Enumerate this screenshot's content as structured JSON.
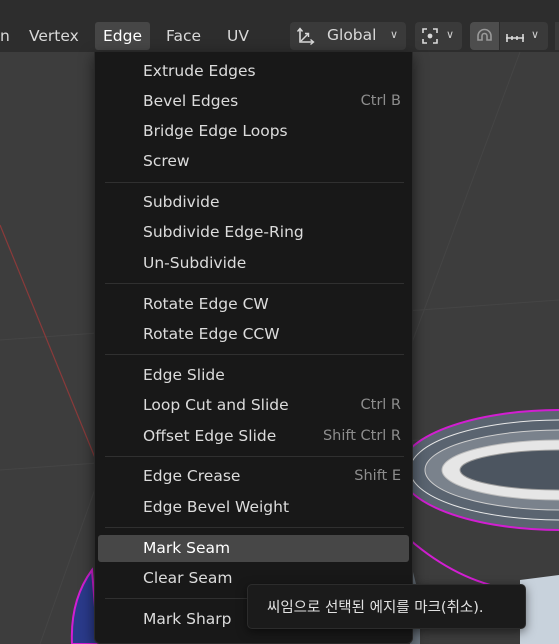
{
  "header": {
    "menus": [
      {
        "label": "n"
      },
      {
        "label": "Vertex"
      },
      {
        "label": "Edge",
        "active": true
      },
      {
        "label": "Face"
      },
      {
        "label": "UV"
      }
    ],
    "transform_orientation": {
      "label": "Global",
      "icon": "transform-orientation-icon"
    },
    "pivot_icon": "pivot-point-icon",
    "snap_icon": "snap-magnet-icon",
    "snap_target_icon": "snap-increment-icon"
  },
  "edge_menu": {
    "groups": [
      [
        {
          "label": "Extrude Edges",
          "shortcut": ""
        },
        {
          "label": "Bevel Edges",
          "shortcut": "Ctrl B"
        },
        {
          "label": "Bridge Edge Loops",
          "shortcut": ""
        },
        {
          "label": "Screw",
          "shortcut": ""
        }
      ],
      [
        {
          "label": "Subdivide",
          "shortcut": ""
        },
        {
          "label": "Subdivide Edge-Ring",
          "shortcut": ""
        },
        {
          "label": "Un-Subdivide",
          "shortcut": ""
        }
      ],
      [
        {
          "label": "Rotate Edge CW",
          "shortcut": ""
        },
        {
          "label": "Rotate Edge CCW",
          "shortcut": ""
        }
      ],
      [
        {
          "label": "Edge Slide",
          "shortcut": ""
        },
        {
          "label": "Loop Cut and Slide",
          "shortcut": "Ctrl R"
        },
        {
          "label": "Offset Edge Slide",
          "shortcut": "Shift Ctrl R"
        }
      ],
      [
        {
          "label": "Edge Crease",
          "shortcut": "Shift E"
        },
        {
          "label": "Edge Bevel Weight",
          "shortcut": ""
        }
      ],
      [
        {
          "label": "Mark Seam",
          "shortcut": "",
          "highlighted": true
        },
        {
          "label": "Clear Seam",
          "shortcut": ""
        }
      ],
      [
        {
          "label": "Mark Sharp",
          "shortcut": ""
        }
      ]
    ]
  },
  "tooltip": {
    "text": "씨임으로 선택된 에지를 마크(취소)."
  },
  "colors": {
    "header_bg": "#2d2d2d",
    "menu_bg": "#181818",
    "highlight": "#474747",
    "viewport_bg": "#3d3d3d",
    "mesh_outline": "#d21ed2",
    "axis_line": "#8a3a3a"
  }
}
